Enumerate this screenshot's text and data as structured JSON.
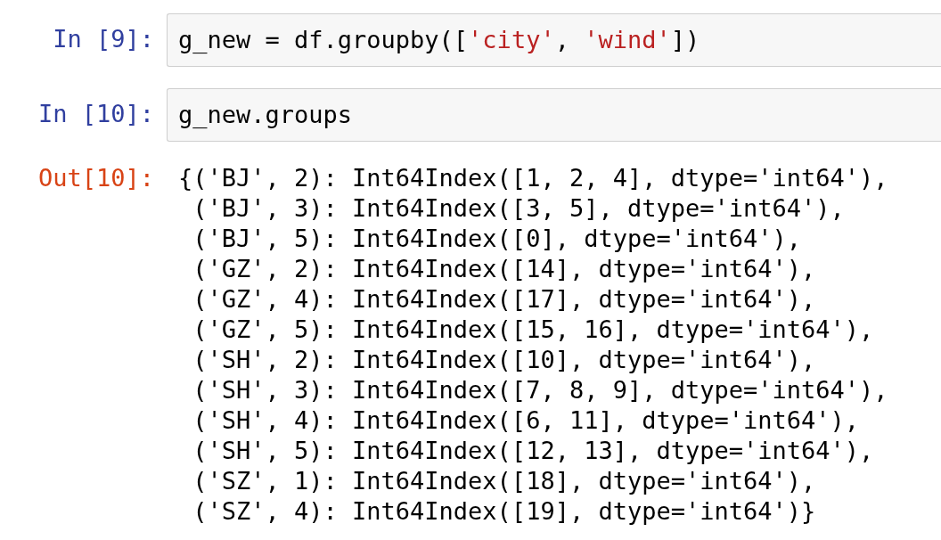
{
  "cells": [
    {
      "kind": "input",
      "prompt": "In [9]:",
      "code": [
        {
          "kind": "plain",
          "text": "g_new = df.groupby(["
        },
        {
          "kind": "string",
          "text": "'city'"
        },
        {
          "kind": "plain",
          "text": ", "
        },
        {
          "kind": "string",
          "text": "'wind'"
        },
        {
          "kind": "plain",
          "text": "])"
        }
      ]
    },
    {
      "kind": "input",
      "prompt": "In [10]:",
      "code": [
        {
          "kind": "plain",
          "text": "g_new.groups"
        }
      ]
    },
    {
      "kind": "output",
      "prompt": "Out[10]:",
      "lines": [
        "{('BJ', 2): Int64Index([1, 2, 4], dtype='int64'),",
        " ('BJ', 3): Int64Index([3, 5], dtype='int64'),",
        " ('BJ', 5): Int64Index([0], dtype='int64'),",
        " ('GZ', 2): Int64Index([14], dtype='int64'),",
        " ('GZ', 4): Int64Index([17], dtype='int64'),",
        " ('GZ', 5): Int64Index([15, 16], dtype='int64'),",
        " ('SH', 2): Int64Index([10], dtype='int64'),",
        " ('SH', 3): Int64Index([7, 8, 9], dtype='int64'),",
        " ('SH', 4): Int64Index([6, 11], dtype='int64'),",
        " ('SH', 5): Int64Index([12, 13], dtype='int64'),",
        " ('SZ', 1): Int64Index([18], dtype='int64'),",
        " ('SZ', 4): Int64Index([19], dtype='int64')}"
      ]
    }
  ]
}
